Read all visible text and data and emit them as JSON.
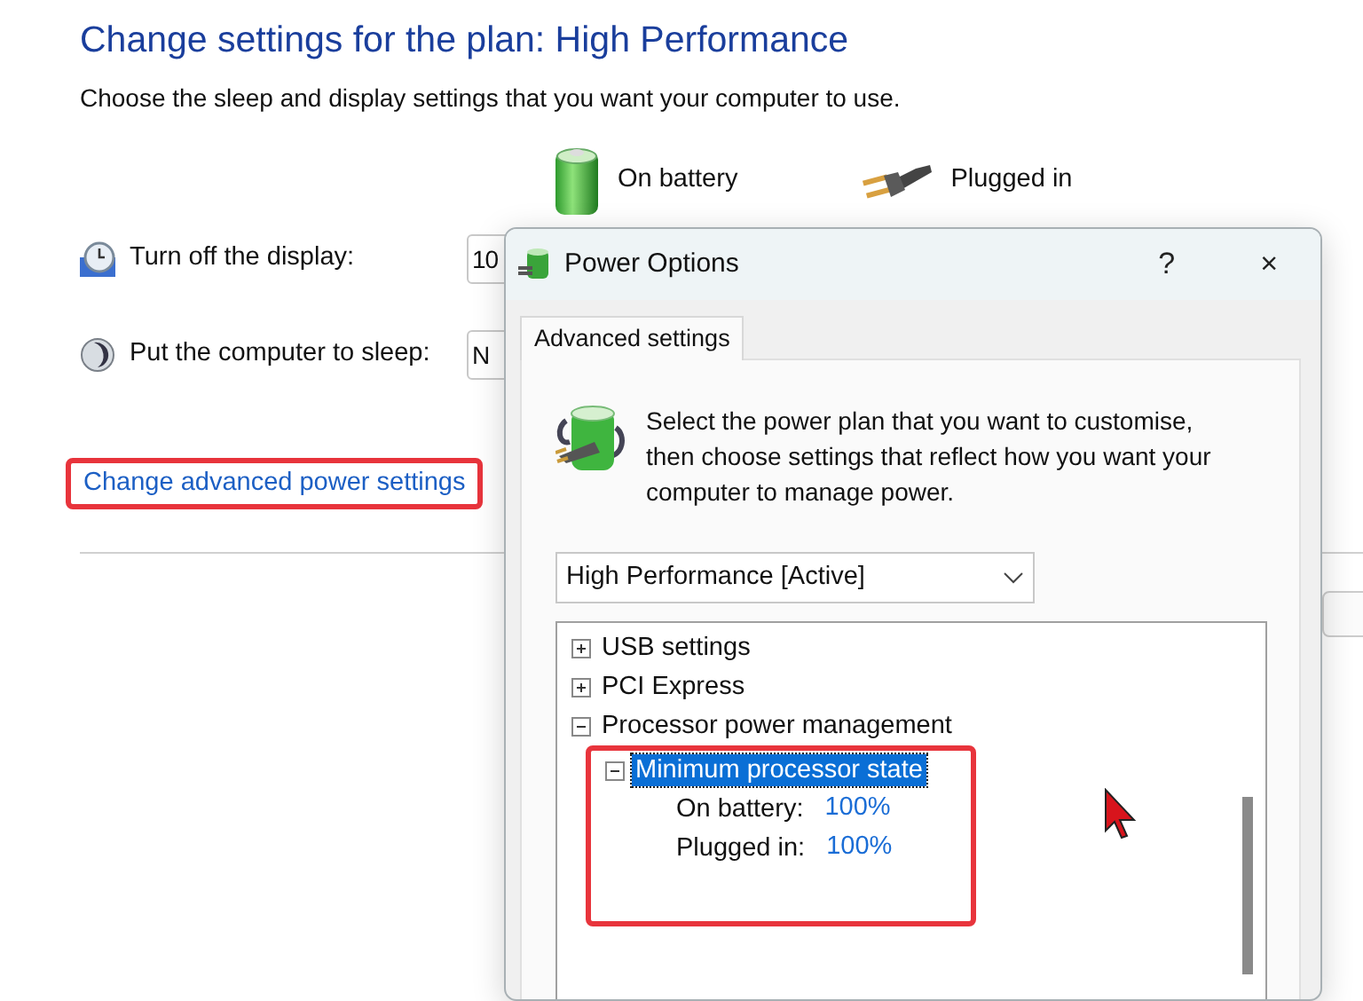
{
  "plan_settings": {
    "title": "Change settings for the plan: High Performance",
    "description": "Choose the sleep and display settings that you want your computer to use.",
    "columns": [
      {
        "label": "On battery",
        "kind": "battery"
      },
      {
        "label": "Plugged in",
        "kind": "plug"
      }
    ],
    "rows": [
      {
        "label": "Turn off the display:",
        "kind": "display",
        "value": "10"
      },
      {
        "label": "Put the computer to sleep:",
        "kind": "sleep",
        "value": "N"
      }
    ],
    "advanced_link": {
      "text": "Change advanced power settings",
      "highlighted": true
    }
  },
  "dialog": {
    "title": "Power Options",
    "help": "?",
    "close": "×",
    "tabs": [
      {
        "label": "Advanced settings",
        "selected": true
      }
    ],
    "intro": "Select the power plan that you want to customise, then choose settings that reflect how you want your computer to manage power.",
    "plan_select": "High Performance [Active]",
    "tree": [
      {
        "label": "USB settings",
        "expanded": false,
        "selected": false
      },
      {
        "label": "PCI Express",
        "expanded": false,
        "selected": false
      },
      {
        "label": "Processor power management",
        "expanded": true,
        "selected": false,
        "children": [
          {
            "label": "Minimum processor state",
            "expanded": true,
            "selected": true,
            "highlighted": true,
            "children": [
              {
                "label": "On battery:",
                "value": "100%",
                "selected": false
              },
              {
                "label": "Plugged in:",
                "value": "100%",
                "selected": false
              }
            ]
          }
        ]
      }
    ]
  }
}
